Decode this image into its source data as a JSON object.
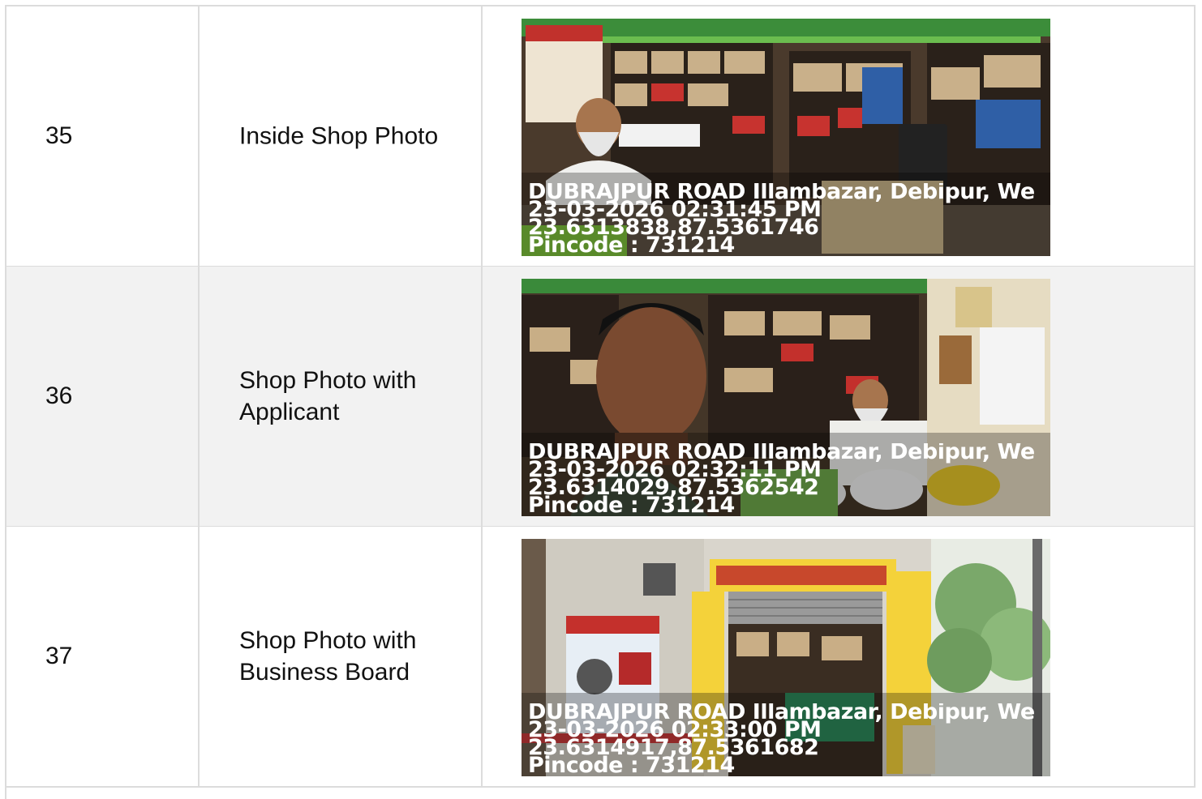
{
  "rows": [
    {
      "number": "35",
      "label": "Inside Shop Photo",
      "photo": {
        "subject": "shop interior with shopkeeper seated at counter",
        "stamp": {
          "address": "DUBRAJPUR ROAD Illambazar, Debipur, We",
          "datetime": "23-03-2026 02:31:45 PM",
          "coords": "23.6313838,87.5361746",
          "pincode": "Pincode : 731214"
        }
      }
    },
    {
      "number": "36",
      "label": "Shop Photo with Applicant",
      "photo": {
        "subject": "selfie of applicant inside shop with shopkeeper",
        "stamp": {
          "address": "DUBRAJPUR ROAD Illambazar, Debipur, We",
          "datetime": "23-03-2026 02:32:11 PM",
          "coords": "23.6314029,87.5362542",
          "pincode": "Pincode : 731214"
        }
      }
    },
    {
      "number": "37",
      "label": "Shop Photo with Business Board",
      "photo": {
        "subject": "shop front with yellow business board",
        "stamp": {
          "address": "DUBRAJPUR ROAD Illambazar, Debipur, We",
          "datetime": "23-03-2026 02:33:00 PM",
          "coords": "23.6314917,87.5361682",
          "pincode": "Pincode : 731214"
        }
      }
    }
  ],
  "colors": {
    "border": "#dcdcdc",
    "row_alt": "#f2f2f2",
    "text": "#111111",
    "stamp_text": "#ffffff"
  }
}
